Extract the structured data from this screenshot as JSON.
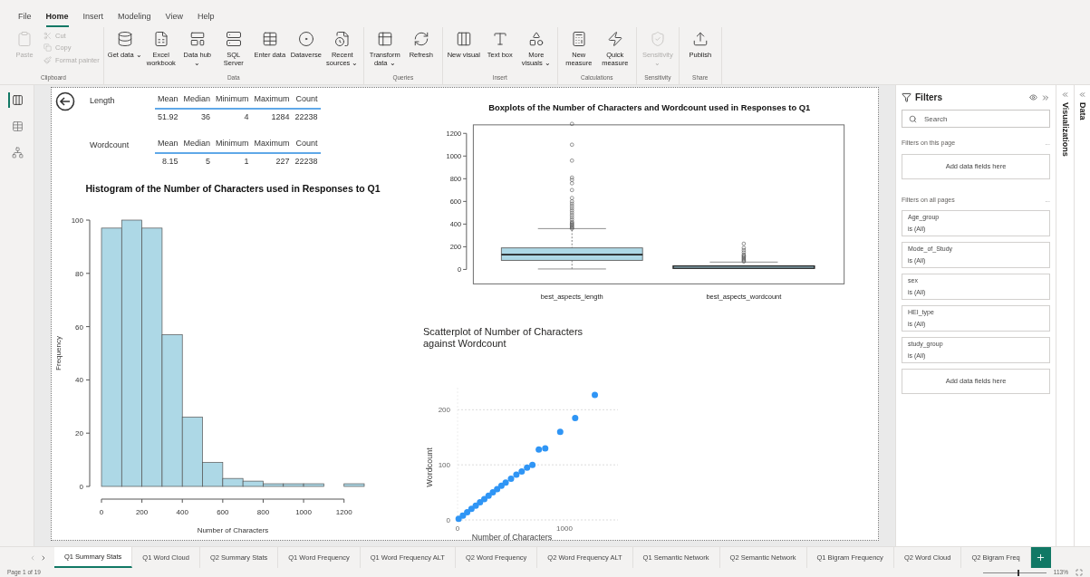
{
  "menu_tabs": [
    {
      "label": "File",
      "selected": false
    },
    {
      "label": "Home",
      "selected": true
    },
    {
      "label": "Insert",
      "selected": false
    },
    {
      "label": "Modeling",
      "selected": false
    },
    {
      "label": "View",
      "selected": false
    },
    {
      "label": "Help",
      "selected": false
    }
  ],
  "ribbon_groups": [
    {
      "label": "Clipboard",
      "buttons": [
        {
          "kind": "large",
          "label": "Paste",
          "disabled": true
        },
        {
          "kind": "small",
          "label": "Cut",
          "disabled": true
        },
        {
          "kind": "small",
          "label": "Copy",
          "disabled": true
        },
        {
          "kind": "small",
          "label": "Format painter",
          "disabled": true
        }
      ]
    },
    {
      "label": "Data",
      "buttons": [
        {
          "kind": "large",
          "label": "Get data ⌄",
          "disabled": false
        },
        {
          "kind": "large",
          "label": "Excel workbook",
          "disabled": false
        },
        {
          "kind": "large",
          "label": "Data hub ⌄",
          "disabled": false
        },
        {
          "kind": "large",
          "label": "SQL Server",
          "disabled": false
        },
        {
          "kind": "large",
          "label": "Enter data",
          "disabled": false
        },
        {
          "kind": "large",
          "label": "Dataverse",
          "disabled": false
        },
        {
          "kind": "large",
          "label": "Recent sources ⌄",
          "disabled": false
        }
      ]
    },
    {
      "label": "Queries",
      "buttons": [
        {
          "kind": "large",
          "label": "Transform data ⌄",
          "disabled": false
        },
        {
          "kind": "large",
          "label": "Refresh",
          "disabled": false
        }
      ]
    },
    {
      "label": "Insert",
      "buttons": [
        {
          "kind": "large",
          "label": "New visual",
          "disabled": false
        },
        {
          "kind": "large",
          "label": "Text box",
          "disabled": false
        },
        {
          "kind": "large",
          "label": "More visuals ⌄",
          "disabled": false
        }
      ]
    },
    {
      "label": "Calculations",
      "buttons": [
        {
          "kind": "large",
          "label": "New measure",
          "disabled": false
        },
        {
          "kind": "large",
          "label": "Quick measure",
          "disabled": false
        }
      ]
    },
    {
      "label": "Sensitivity",
      "buttons": [
        {
          "kind": "large",
          "label": "Sensitivity ⌄",
          "disabled": true
        }
      ]
    },
    {
      "label": "Share",
      "buttons": [
        {
          "kind": "large",
          "label": "Publish",
          "disabled": false
        }
      ]
    }
  ],
  "nav": [
    {
      "selected": true
    },
    {
      "selected": false
    },
    {
      "selected": false
    }
  ],
  "stats_tables": [
    {
      "label": "Length",
      "columns": [
        "Mean",
        "Median",
        "Minimum",
        "Maximum",
        "Count"
      ],
      "values": [
        "51.92",
        "36",
        "4",
        "1284",
        "22238"
      ]
    },
    {
      "label": "Wordcount",
      "columns": [
        "Mean",
        "Median",
        "Minimum",
        "Maximum",
        "Count"
      ],
      "values": [
        "8.15",
        "5",
        "1",
        "227",
        "22238"
      ]
    }
  ],
  "histogram": {
    "chart_data": {
      "type": "bar",
      "title": "Histogram of the Number of Characters used in Responses to Q1",
      "xlabel": "Number of Characters",
      "ylabel": "Frequency",
      "x": [
        50,
        150,
        250,
        350,
        450,
        550,
        650,
        750,
        850,
        950,
        1050,
        1150,
        1250
      ],
      "series": [
        {
          "color": "#add8e6",
          "values": [
            97,
            100,
            97,
            57,
            26,
            9,
            3,
            2,
            1,
            1,
            1,
            0,
            1
          ]
        }
      ],
      "xlim": [
        0,
        1300
      ],
      "ylim": [
        0,
        100
      ],
      "xticks": [
        0,
        200,
        400,
        600,
        800,
        1000,
        1200
      ],
      "yticks": [
        0,
        20,
        40,
        60,
        80,
        100
      ]
    }
  },
  "boxplot": {
    "title": "Boxplots of the Number of Characters and Wordcount used in Responses to Q1",
    "yticks": [
      "1200",
      "1000",
      "800",
      "600",
      "400",
      "200",
      "0"
    ],
    "categories": [
      "best_aspects_length",
      "best_aspects_wordcount"
    ]
  },
  "scatter": {
    "chart_data": {
      "type": "scatter",
      "title": "Scatterplot of Number of Characters against Wordcount",
      "xlabel": "Number of Characters",
      "ylabel": "Wordcount",
      "x": [
        10,
        50,
        90,
        130,
        170,
        210,
        250,
        290,
        330,
        370,
        410,
        450,
        500,
        550,
        600,
        650,
        700,
        760,
        820,
        960,
        1100,
        1284
      ],
      "series": [
        {
          "color": "#2f95f5",
          "values": [
            2,
            8,
            14,
            20,
            26,
            32,
            38,
            44,
            50,
            56,
            62,
            68,
            75,
            82,
            88,
            95,
            100,
            128,
            130,
            160,
            185,
            227
          ]
        }
      ],
      "xlim": [
        0,
        1500
      ],
      "ylim": [
        0,
        240
      ],
      "xticks": [
        0,
        1000
      ],
      "yticks": [
        0,
        100,
        200
      ]
    }
  },
  "filters": {
    "title": "Filters",
    "search_placeholder": "Search",
    "page_section": "Filters on this page",
    "page_more": "...",
    "page_add": "Add data fields here",
    "all_section": "Filters on all pages",
    "all_more": "...",
    "items": [
      {
        "field": "Age_group",
        "value": "is (All)"
      },
      {
        "field": "Mode_of_Study",
        "value": "is (All)"
      },
      {
        "field": "sex",
        "value": "is (All)"
      },
      {
        "field": "HEI_type",
        "value": "is (All)"
      },
      {
        "field": "study_group",
        "value": "is (All)"
      }
    ],
    "all_add": "Add data fields here"
  },
  "visualizations_pane": {
    "title": "Visualizations"
  },
  "data_pane": {
    "title": "Data"
  },
  "page_tabs": [
    {
      "label": "Q1 Summary Stats",
      "selected": true
    },
    {
      "label": "Q1 Word Cloud",
      "selected": false
    },
    {
      "label": "Q2 Summary Stats",
      "selected": false
    },
    {
      "label": "Q1 Word Frequency",
      "selected": false
    },
    {
      "label": "Q1 Word Frequency ALT",
      "selected": false
    },
    {
      "label": "Q2 Word Frequency",
      "selected": false
    },
    {
      "label": "Q2 Word Frequency ALT",
      "selected": false
    },
    {
      "label": "Q1 Semantic Network",
      "selected": false
    },
    {
      "label": "Q2 Semantic Network",
      "selected": false
    },
    {
      "label": "Q1 Bigram Frequency",
      "selected": false
    },
    {
      "label": "Q2 Word Cloud",
      "selected": false
    },
    {
      "label": "Q2 Bigram Freq",
      "selected": false
    }
  ],
  "status_bar": {
    "page": "Page 1 of 19",
    "zoom": "113%",
    "level": 0.55
  }
}
